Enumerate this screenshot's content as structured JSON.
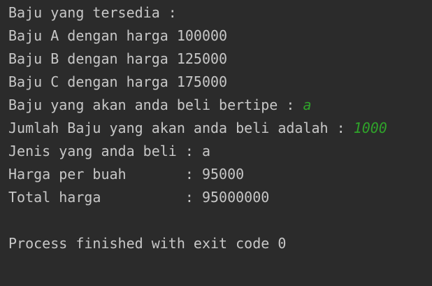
{
  "console": {
    "lines": [
      {
        "text": "Baju yang tersedia :"
      },
      {
        "text": "Baju A dengan harga 100000"
      },
      {
        "text": "Baju B dengan harga 125000"
      },
      {
        "text": "Baju C dengan harga 175000"
      },
      {
        "text": "Baju yang akan anda beli bertipe : ",
        "input": "a"
      },
      {
        "text": "Jumlah Baju yang akan anda beli adalah : ",
        "input": "1000"
      },
      {
        "text": "Jenis yang anda beli : a"
      },
      {
        "text": "Harga per buah       : 95000"
      },
      {
        "text": "Total harga          : 95000000"
      },
      {
        "text": ""
      },
      {
        "text": "Process finished with exit code 0"
      }
    ]
  },
  "colors": {
    "background": "#2b2b2b",
    "text": "#c7c7c7",
    "user_input": "#2fa32a"
  }
}
